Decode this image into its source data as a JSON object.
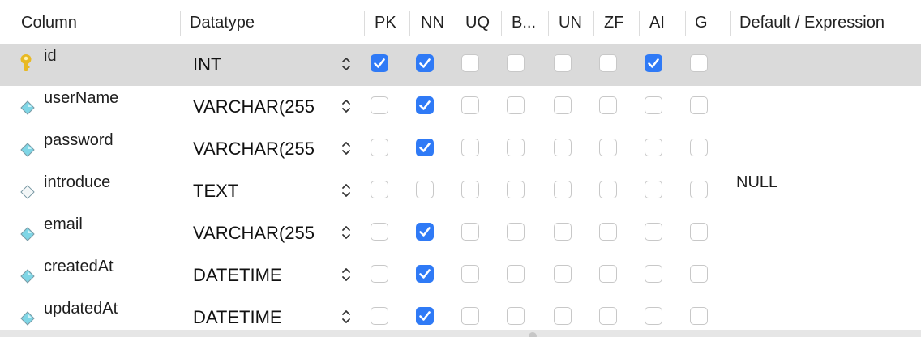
{
  "headers": {
    "column": "Column",
    "datatype": "Datatype",
    "pk": "PK",
    "nn": "NN",
    "uq": "UQ",
    "b": "B...",
    "un": "UN",
    "zf": "ZF",
    "ai": "AI",
    "g": "G",
    "default": "Default / Expression"
  },
  "rows": [
    {
      "name": "id",
      "datatype": "INT",
      "icon": "key-icon",
      "pk": true,
      "nn": true,
      "uq": false,
      "b": false,
      "un": false,
      "zf": false,
      "ai": true,
      "g": false,
      "default": "",
      "selected": true
    },
    {
      "name": "userName",
      "datatype": "VARCHAR(255",
      "icon": "diamond-filled-icon",
      "pk": false,
      "nn": true,
      "uq": false,
      "b": false,
      "un": false,
      "zf": false,
      "ai": false,
      "g": false,
      "default": "",
      "selected": false
    },
    {
      "name": "password",
      "datatype": "VARCHAR(255",
      "icon": "diamond-filled-icon",
      "pk": false,
      "nn": true,
      "uq": false,
      "b": false,
      "un": false,
      "zf": false,
      "ai": false,
      "g": false,
      "default": "",
      "selected": false
    },
    {
      "name": "introduce",
      "datatype": "TEXT",
      "icon": "diamond-outline-icon",
      "pk": false,
      "nn": false,
      "uq": false,
      "b": false,
      "un": false,
      "zf": false,
      "ai": false,
      "g": false,
      "default": "NULL",
      "selected": false
    },
    {
      "name": "email",
      "datatype": "VARCHAR(255",
      "icon": "diamond-filled-icon",
      "pk": false,
      "nn": true,
      "uq": false,
      "b": false,
      "un": false,
      "zf": false,
      "ai": false,
      "g": false,
      "default": "",
      "selected": false
    },
    {
      "name": "createdAt",
      "datatype": "DATETIME",
      "icon": "diamond-filled-icon",
      "pk": false,
      "nn": true,
      "uq": false,
      "b": false,
      "un": false,
      "zf": false,
      "ai": false,
      "g": false,
      "default": "",
      "selected": false
    },
    {
      "name": "updatedAt",
      "datatype": "DATETIME",
      "icon": "diamond-filled-icon",
      "pk": false,
      "nn": true,
      "uq": false,
      "b": false,
      "un": false,
      "zf": false,
      "ai": false,
      "g": false,
      "default": "",
      "selected": false
    }
  ],
  "colors": {
    "checkbox_checked": "#2f7af6",
    "selected_row": "#dadada",
    "key_icon": "#e8b923",
    "diamond_icon": "#7fd6e6"
  }
}
